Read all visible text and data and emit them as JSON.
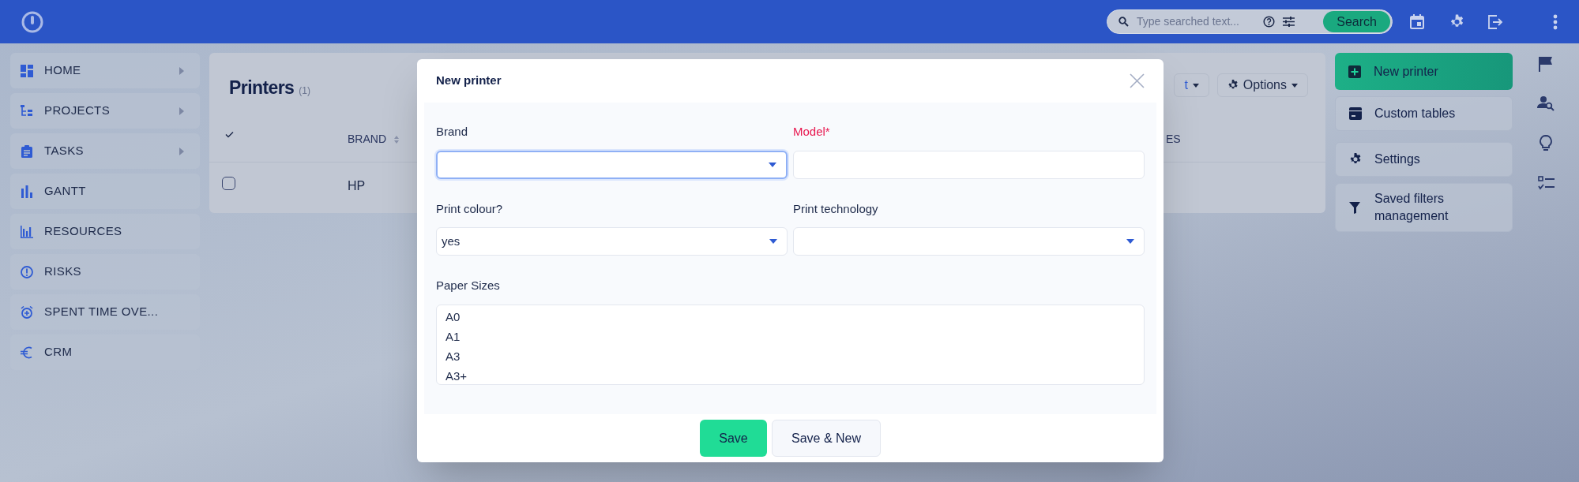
{
  "top_bar": {
    "search": {
      "placeholder": "Type searched text...",
      "button": "Search"
    }
  },
  "sidebar": {
    "items": [
      {
        "label": "HOME",
        "expandable": true
      },
      {
        "label": "PROJECTS",
        "expandable": true
      },
      {
        "label": "TASKS",
        "expandable": true
      },
      {
        "label": "GANTT",
        "expandable": false
      },
      {
        "label": "RESOURCES",
        "expandable": false
      },
      {
        "label": "RISKS",
        "expandable": false
      },
      {
        "label": "SPENT TIME OVE...",
        "expandable": false
      },
      {
        "label": "CRM",
        "expandable": false
      }
    ]
  },
  "page": {
    "title": "Printers",
    "count": "(1)",
    "toolbar": [
      {
        "label": "t",
        "kind": "link"
      },
      {
        "label": "Options",
        "kind": "options"
      }
    ],
    "table": {
      "columns": [
        {
          "label": "BRAND",
          "sortable": true
        },
        {
          "label": "ES",
          "sortable": false
        }
      ],
      "rows": [
        {
          "selected": false,
          "cells": [
            "HP"
          ]
        }
      ]
    }
  },
  "actions": [
    {
      "label": "New printer",
      "primary": true
    },
    {
      "label": "Custom tables",
      "primary": false
    },
    {
      "label": "Settings",
      "primary": false
    },
    {
      "label": "Saved filters management",
      "primary": false
    }
  ],
  "modal": {
    "title": "New printer",
    "fields": [
      {
        "label": "Brand",
        "kind": "select",
        "required": false,
        "focused": true
      },
      {
        "label": "Model*",
        "kind": "text",
        "required": true,
        "focused": false
      },
      {
        "label": "Print colour?",
        "kind": "select",
        "required": false,
        "focused": false,
        "value": "yes"
      },
      {
        "label": "Print technology",
        "kind": "select",
        "required": false,
        "focused": false
      },
      {
        "label": "Paper Sizes",
        "kind": "listbox",
        "required": false,
        "focused": false,
        "options": [
          "A0",
          "A1",
          "A3",
          "A3+"
        ]
      }
    ],
    "buttons": [
      {
        "label": "Save",
        "primary": true
      },
      {
        "label": "Save & New",
        "primary": false
      }
    ]
  }
}
